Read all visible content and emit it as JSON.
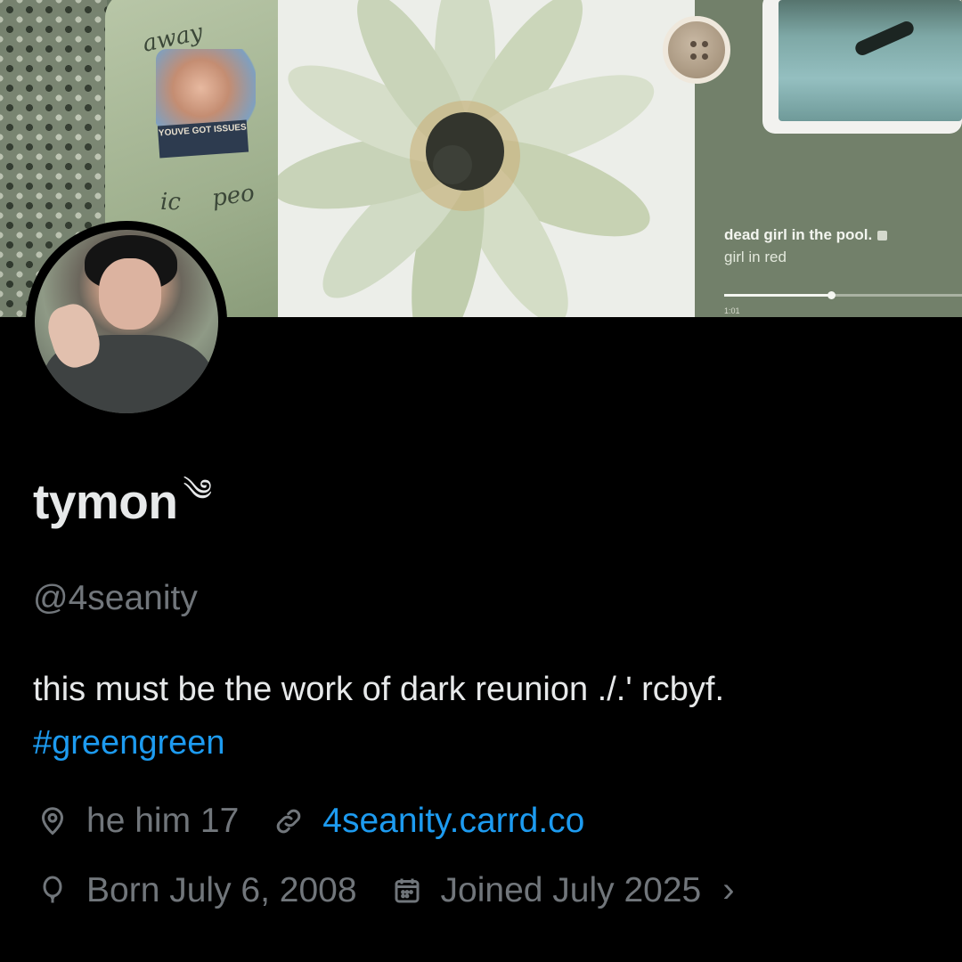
{
  "banner": {
    "shirt_text": {
      "top": "away",
      "tag": "YOUVE GOT ISSUES",
      "left": "ic",
      "right": "peo"
    },
    "now_playing": {
      "title": "dead girl in the pool.",
      "artist": "girl in red",
      "time": "1:01",
      "progress": 0.45
    },
    "colors": {
      "sage": "#72806a",
      "cream": "#e9ebe6"
    }
  },
  "profile": {
    "display_name": "tymon",
    "name_emoji": "༄",
    "handle": "@4seanity",
    "bio_text": "this must be the work of dark reunion ./.' rcbyf.",
    "bio_hashtag": "#greengreen"
  },
  "meta": {
    "location": {
      "icon": "location-pin-icon",
      "text": "he him 17"
    },
    "website": {
      "icon": "link-icon",
      "text": "4seanity.carrd.co"
    },
    "birthday": {
      "icon": "balloon-icon",
      "text": "Born July 6, 2008"
    },
    "joined": {
      "icon": "calendar-icon",
      "text": "Joined July 2025"
    },
    "more": "›"
  },
  "colors": {
    "background": "#000000",
    "text": "#e7e9ea",
    "secondary": "#71767b",
    "link": "#1d9bf0"
  }
}
